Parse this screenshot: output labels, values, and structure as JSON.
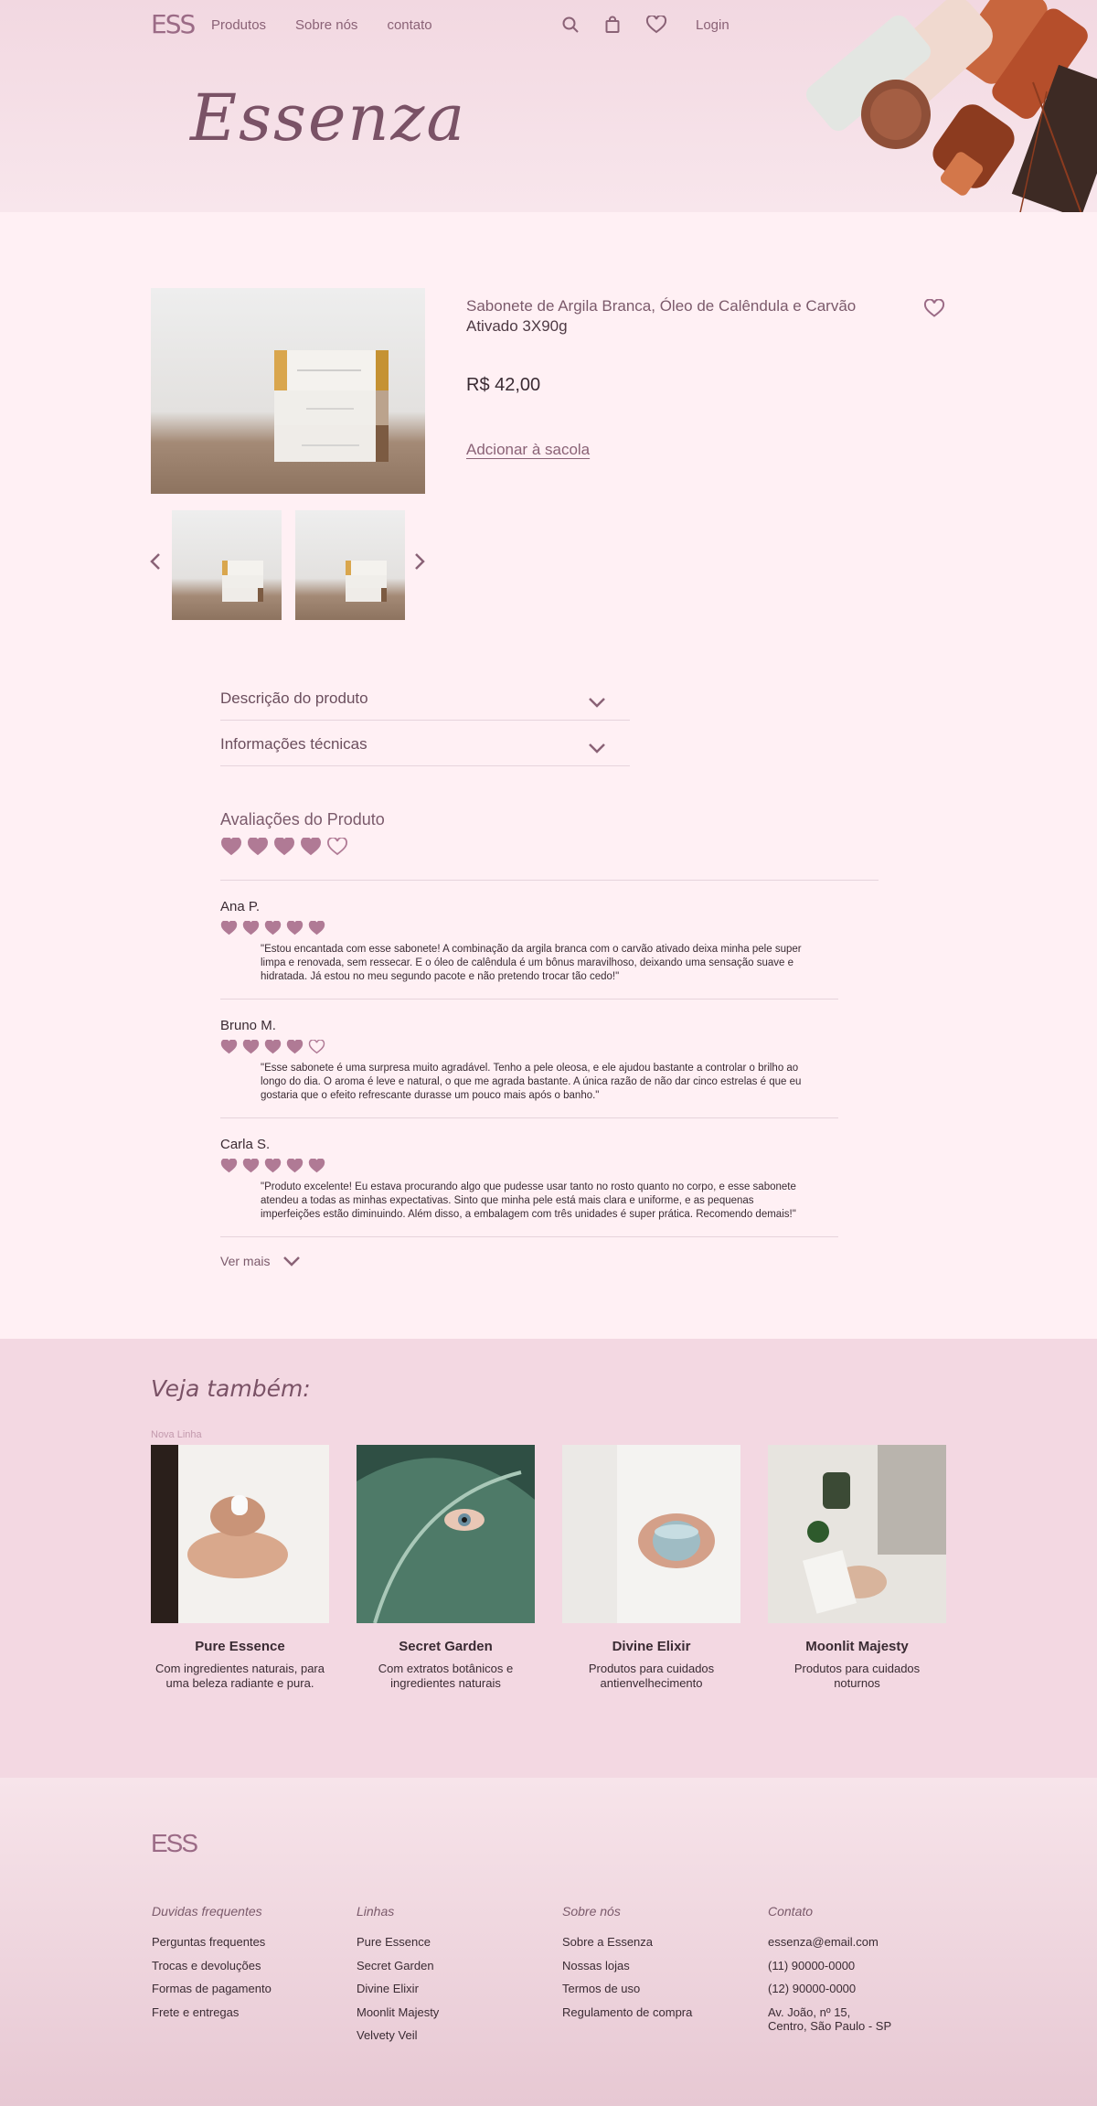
{
  "header": {
    "logo": "ESS",
    "nav": [
      "Produtos",
      "Sobre nós",
      "contato"
    ],
    "login": "Login",
    "brand_title": "Essenza"
  },
  "product": {
    "name_line1": "Sabonete de Argila Branca, Óleo de Calêndula e Carvão",
    "name_line2": "Ativado 3X90g",
    "price": "R$ 42,00",
    "add_to_bag": "Adcionar à sacola"
  },
  "accordions": [
    "Descrição do produto",
    "Informações técnicas"
  ],
  "reviews": {
    "title": "Avaliações do Produto",
    "average_rating": 4,
    "items": [
      {
        "name": "Ana P.",
        "rating": 5,
        "text": "\"Estou encantada com esse sabonete! A combinação da argila branca com o carvão ativado deixa minha pele super limpa e renovada, sem ressecar. E o óleo de calêndula é um bônus maravilhoso, deixando uma sensação suave e hidratada. Já estou no meu segundo pacote e não pretendo trocar tão cedo!\""
      },
      {
        "name": "Bruno M.",
        "rating": 4,
        "text": "\"Esse sabonete é uma surpresa muito agradável. Tenho a pele oleosa, e ele ajudou bastante a controlar o brilho ao longo do dia. O aroma é leve e natural, o que me agrada bastante. A única razão de não dar cinco estrelas é que eu gostaria que o efeito refrescante durasse um pouco mais após o banho.\""
      },
      {
        "name": "Carla S.",
        "rating": 5,
        "text": "\"Produto excelente! Eu estava procurando algo que pudesse usar tanto no rosto quanto no corpo, e esse sabonete atendeu a todas as minhas expectativas. Sinto que minha pele está mais clara e uniforme, e as pequenas imperfeições estão diminuindo. Além disso, a embalagem com três unidades é super prática. Recomendo demais!\""
      }
    ],
    "see_more": "Ver mais"
  },
  "see_also": {
    "title": "Veja também:",
    "tag": "Nova Linha",
    "cards": [
      {
        "title": "Pure Essence",
        "desc": "Com ingredientes naturais, para uma beleza radiante e pura."
      },
      {
        "title": "Secret Garden",
        "desc": "Com extratos botânicos e ingredientes naturais"
      },
      {
        "title": "Divine Elixir",
        "desc": "Produtos para cuidados antienvelhecimento"
      },
      {
        "title": "Moonlit Majesty",
        "desc": "Produtos para cuidados noturnos"
      }
    ]
  },
  "footer": {
    "logo": "ESS",
    "columns": [
      {
        "title": "Duvidas frequentes",
        "links": [
          "Perguntas frequentes",
          "Trocas e devoluções",
          "Formas de pagamento",
          "Frete e entregas"
        ]
      },
      {
        "title": "Linhas",
        "links": [
          "Pure Essence",
          "Secret Garden",
          "Divine Elixir",
          "Moonlit  Majesty",
          "Velvety Veil"
        ]
      },
      {
        "title": "Sobre nós",
        "links": [
          "Sobre a Essenza",
          "Nossas lojas",
          "Termos de uso",
          "Regulamento de compra"
        ]
      },
      {
        "title": "Contato",
        "links": [
          "essenza@email.com",
          "(11) 90000-0000",
          "(12) 90000-0000",
          "Av. João, nº 15,\nCentro, São Paulo - SP"
        ]
      }
    ]
  },
  "colors": {
    "accent": "#b07a95",
    "brand": "#7a5266",
    "background": "#fff0f4"
  }
}
